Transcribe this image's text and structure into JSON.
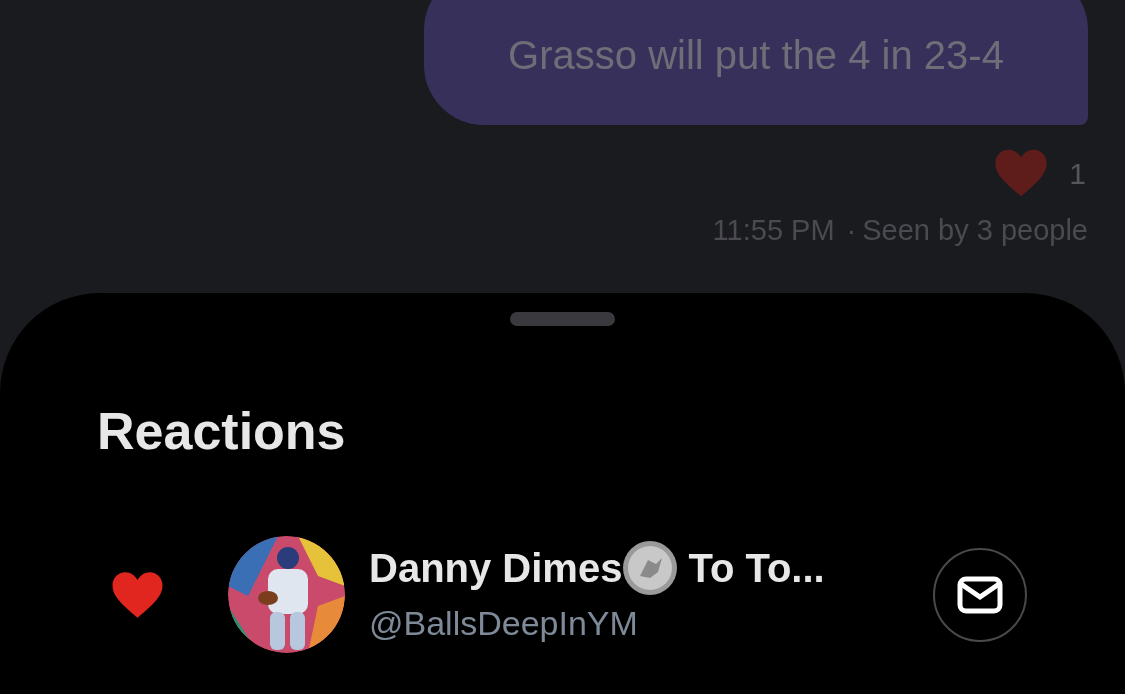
{
  "message": {
    "text": "Grasso will put the 4 in 23-4",
    "reaction_count": "1",
    "time": "11:55 PM",
    "separator": "·",
    "seen": "Seen by 3 people"
  },
  "sheet": {
    "title": "Reactions",
    "reactions": [
      {
        "name_start": "Danny Dimes",
        "name_end": "To To...",
        "handle": "@BallsDeepInYM"
      }
    ]
  }
}
